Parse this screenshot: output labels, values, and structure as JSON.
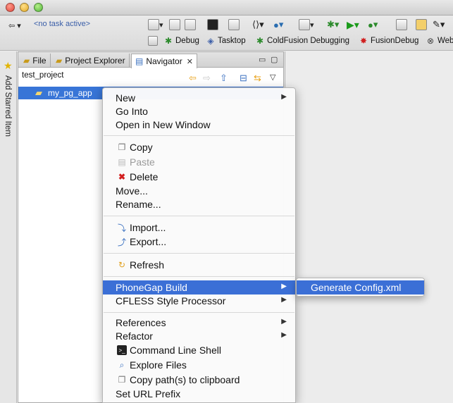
{
  "toolbar": {
    "task_label": "<no task active>",
    "perspectives": [
      {
        "label": "Debug",
        "icon": "bug-icon"
      },
      {
        "label": "Tasktop",
        "icon": "tasktop-icon"
      },
      {
        "label": "ColdFusion Debugging",
        "icon": "bug-icon"
      },
      {
        "label": "FusionDebug",
        "icon": "fusiondebug-icon"
      },
      {
        "label": "Web",
        "icon": "web-icon"
      }
    ]
  },
  "sidebar": {
    "starred_label": "Add Starred Item"
  },
  "view": {
    "tabs": [
      {
        "label": "File"
      },
      {
        "label": "Project Explorer"
      },
      {
        "label": "Navigator"
      }
    ],
    "project": "test_project",
    "tree_item": "my_pg_app"
  },
  "context_menu": {
    "items": [
      {
        "label": "New",
        "submenu": true
      },
      {
        "label": "Go Into"
      },
      {
        "label": "Open in New Window"
      },
      {
        "label": "Copy",
        "icon": "copy-icon"
      },
      {
        "label": "Paste",
        "icon": "paste-icon",
        "disabled": true
      },
      {
        "label": "Delete",
        "icon": "delete-icon"
      },
      {
        "label": "Move..."
      },
      {
        "label": "Rename..."
      },
      {
        "label": "Import...",
        "icon": "import-icon"
      },
      {
        "label": "Export...",
        "icon": "export-icon"
      },
      {
        "label": "Refresh",
        "icon": "refresh-icon"
      },
      {
        "label": "PhoneGap Build",
        "submenu": true,
        "highlighted": true
      },
      {
        "label": "CFLESS Style Processor",
        "submenu": true
      },
      {
        "label": "References",
        "submenu": true
      },
      {
        "label": "Refactor",
        "submenu": true
      },
      {
        "label": "Command Line Shell",
        "icon": "terminal-icon"
      },
      {
        "label": "Explore Files",
        "icon": "explore-icon"
      },
      {
        "label": "Copy path(s) to clipboard",
        "icon": "clipboard-icon"
      },
      {
        "label": "Set URL Prefix"
      }
    ],
    "submenu": {
      "label": "Generate Config.xml"
    }
  },
  "colors": {
    "selection": "#3b6fd6",
    "tree_selection": "#3875d7"
  }
}
